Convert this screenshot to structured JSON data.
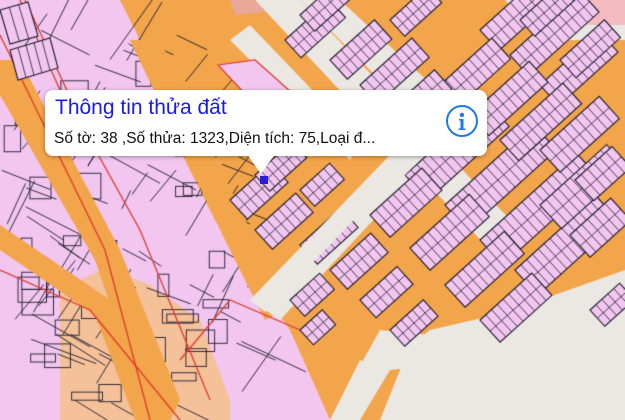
{
  "map": {
    "colors": {
      "road": "#f2a54a",
      "parcel": "#f2c6ef",
      "parcel_alt": "#f4bcc0",
      "parcel_tan": "#f5c199",
      "street": "#ebe8e3",
      "boundary": "#1c1c2e",
      "plan_line": "#e0392e",
      "background": "#f3f1ec"
    }
  },
  "callout": {
    "title": "Thông tin thửa đất",
    "detail": "Số tờ: 38 ,Số thửa: 1323,Diện tích: 75,Loại đ...",
    "title_color": "#1a1ae6",
    "info_icon": "info-icon",
    "accent": "#1e78e6"
  },
  "marker": {
    "icon": "location-marker",
    "color": "#2a1fd4"
  }
}
